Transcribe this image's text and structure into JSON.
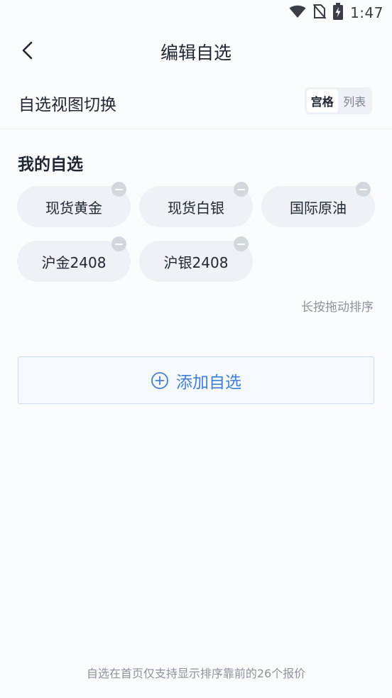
{
  "status_bar": {
    "time": "1:47",
    "icons": [
      "wifi-icon",
      "no-sim-icon",
      "battery-charging-icon"
    ]
  },
  "header": {
    "title": "编辑自选",
    "back_icon": "back-chevron-icon"
  },
  "view_switch": {
    "label": "自选视图切换",
    "options": [
      "宫格",
      "列表"
    ],
    "selected": "宫格"
  },
  "watchlist": {
    "title": "我的自选",
    "items": [
      {
        "label": "现货黄金"
      },
      {
        "label": "现货白银"
      },
      {
        "label": "国际原油"
      },
      {
        "label": "沪金2408"
      },
      {
        "label": "沪银2408"
      }
    ],
    "remove_icon": "remove-minus-icon",
    "hint": "长按拖动排序"
  },
  "add_button": {
    "label": "添加自选",
    "icon": "plus-circle-icon"
  },
  "footer_note": "自选在首页仅支持显示排序靠前的26个报价",
  "colors": {
    "accent": "#3f7fd6",
    "chip_bg": "#eef1f5",
    "remove_badge": "#d3d8df",
    "page_bg": "#fbfcfe"
  }
}
